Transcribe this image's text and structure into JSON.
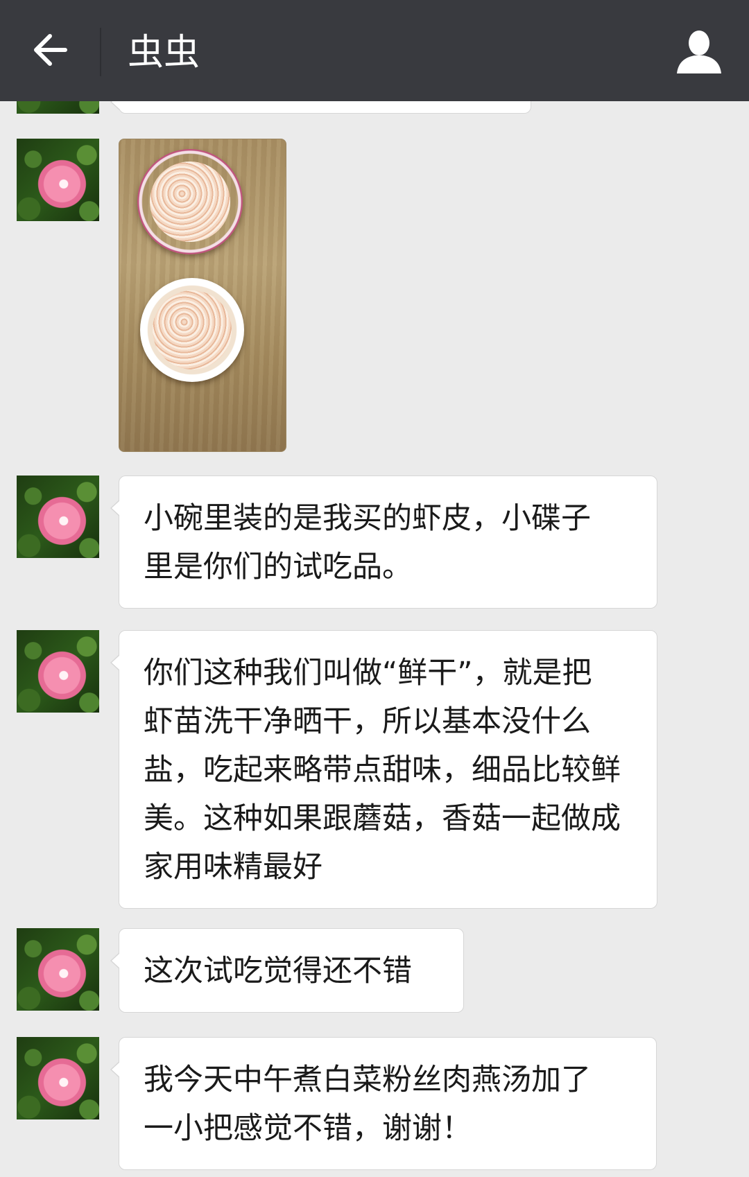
{
  "header": {
    "title": "虫虫",
    "back_icon": "arrow-left-icon",
    "profile_icon": "user-icon"
  },
  "messages": [
    {
      "type": "image",
      "description": "photo-bowls-of-dried-shrimp"
    },
    {
      "type": "text",
      "lines": [
        "小碗里装的是我买的虾皮，小碟子",
        "里是你们的试吃品。"
      ]
    },
    {
      "type": "text",
      "lines": [
        "你们这种我们叫做“鲜干”，就是把",
        "虾苗洗干净晒干，所以基本没什么",
        "盐，吃起来略带点甜味，细品比较鲜",
        "美。这种如果跟蘑菇，香菇一起做成",
        "家用味精最好"
      ]
    },
    {
      "type": "text",
      "lines": [
        "这次试吃觉得还不错"
      ]
    },
    {
      "type": "text",
      "lines": [
        "我今天中午煮白菜粉丝肉燕汤加了",
        "一小把感觉不错，谢谢！"
      ]
    }
  ],
  "colors": {
    "header_bg": "#393a3f",
    "chat_bg": "#ebebeb",
    "bubble_bg": "#ffffff"
  }
}
